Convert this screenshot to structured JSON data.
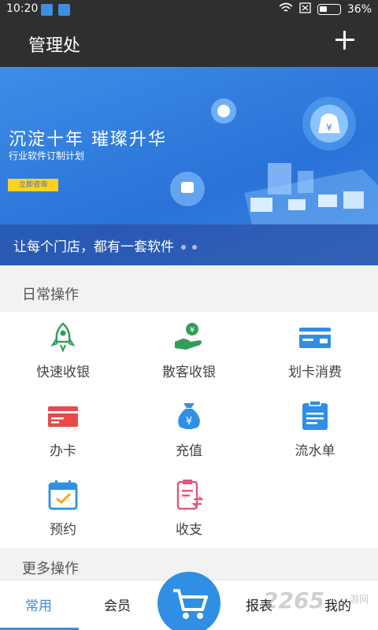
{
  "status": {
    "time": "10:20",
    "battery": "36%"
  },
  "header": {
    "title": "管理处"
  },
  "banner": {
    "headline": "沉淀十年  璀璨升华",
    "subhead": "行业软件订制计划",
    "button": "立即咨询",
    "slogan": "让每个门店，都有一套软件",
    "icons": [
      "money-bag-icon",
      "coins-icon",
      "coin-icon"
    ]
  },
  "daily": {
    "title": "日常操作",
    "items": [
      {
        "label": "快速收银",
        "icon": "rocket-icon",
        "color": "#2f9e5a"
      },
      {
        "label": "散客收银",
        "icon": "hand-coin-icon",
        "color": "#2f9e5a"
      },
      {
        "label": "划卡消费",
        "icon": "card-icon",
        "color": "#2f8fe4"
      },
      {
        "label": "办卡",
        "icon": "red-card-icon",
        "color": "#e84a4a"
      },
      {
        "label": "充值",
        "icon": "money-bag-icon",
        "color": "#2f8fe4"
      },
      {
        "label": "流水单",
        "icon": "clipboard-icon",
        "color": "#2f8fe4"
      },
      {
        "label": "预约",
        "icon": "calendar-icon",
        "color": "#2f8fe4"
      },
      {
        "label": "收支",
        "icon": "ledger-icon",
        "color": "#e05a7a"
      }
    ]
  },
  "more": {
    "title": "更多操作"
  },
  "nav": {
    "tabs": [
      "常用",
      "会员",
      "报表",
      "我的"
    ],
    "active_index": 0,
    "cart_icon": "shopping-cart-icon"
  },
  "watermark": {
    "main": "2265",
    "tail": "游网"
  }
}
